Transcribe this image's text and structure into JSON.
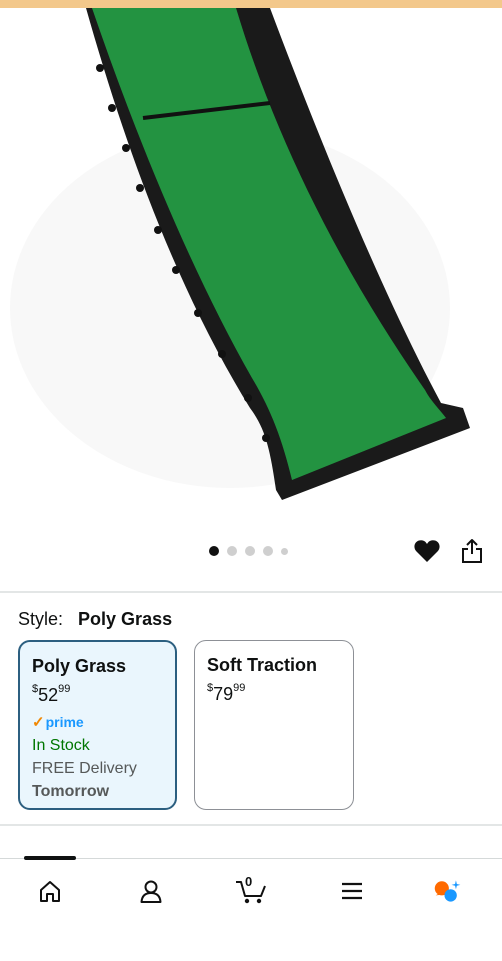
{
  "product": {
    "image_alt": "Green grass ramp with black frame",
    "carousel": {
      "total": 5,
      "active_index": 0
    }
  },
  "actions": {
    "favorite_icon": "heart-icon",
    "share_icon": "share-icon"
  },
  "style": {
    "label": "Style:",
    "selected": "Poly Grass"
  },
  "options": [
    {
      "name": "Poly Grass",
      "currency": "$",
      "whole": "52",
      "fraction": "99",
      "prime": "prime",
      "stock": "In Stock",
      "delivery": "FREE Delivery",
      "when": "Tomorrow",
      "selected": true
    },
    {
      "name": "Soft Traction",
      "currency": "$",
      "whole": "79",
      "fraction": "99",
      "selected": false
    }
  ],
  "nav": {
    "cart_count": "0",
    "tabs": [
      "home-icon",
      "account-icon",
      "cart-icon",
      "menu-icon",
      "rufus-icon"
    ]
  },
  "colors": {
    "accent_border": "#2c5f80",
    "selected_bg": "#eaf6fd",
    "in_stock": "#007600",
    "prime_blue": "#1a98ff",
    "prime_check": "#f08804",
    "top_bar": "#f3c88b"
  }
}
